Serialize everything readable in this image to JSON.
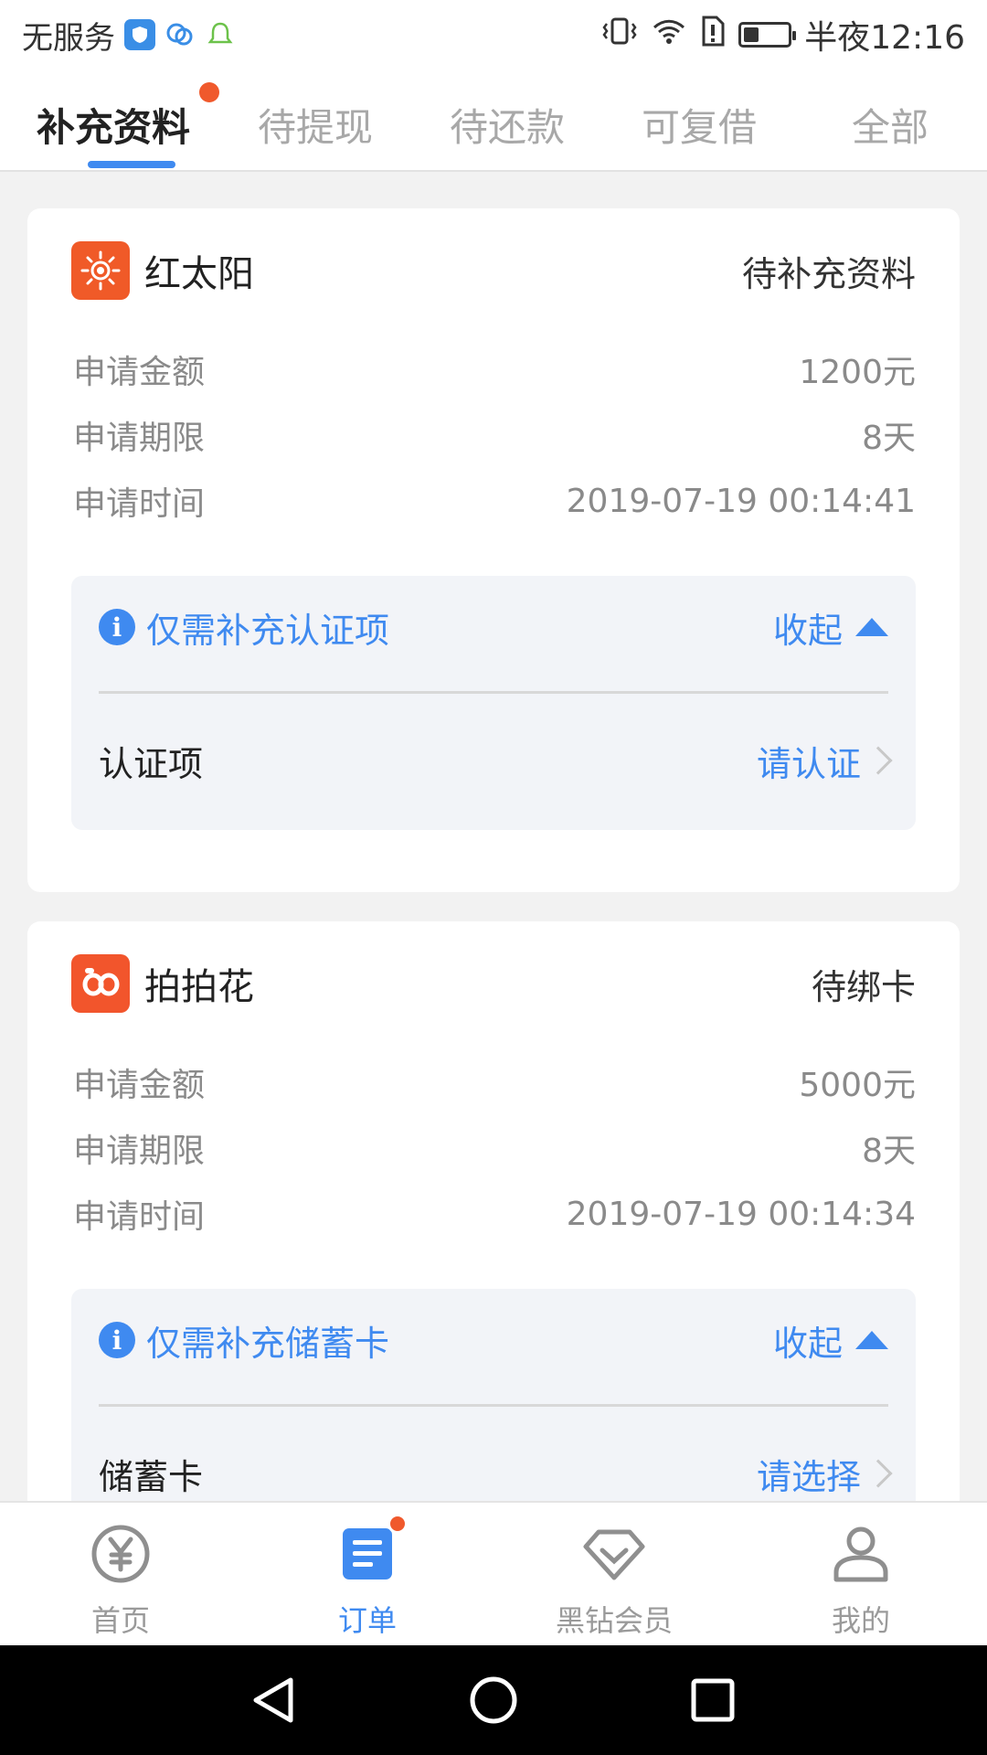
{
  "status_bar": {
    "carrier": "无服务",
    "time": "半夜12:16"
  },
  "tabs": [
    {
      "label": "补充资料",
      "active": true
    },
    {
      "label": "待提现"
    },
    {
      "label": "待还款"
    },
    {
      "label": "可复借"
    },
    {
      "label": "全部"
    }
  ],
  "cards": [
    {
      "brand": "红太阳",
      "status": "待补充资料",
      "rows": [
        {
          "label": "申请金额",
          "value": "1200元"
        },
        {
          "label": "申请期限",
          "value": "8天"
        },
        {
          "label": "申请时间",
          "value": "2019-07-19 00:14:41"
        }
      ],
      "panel": {
        "title": "仅需补充认证项",
        "collapse": "收起",
        "item_label": "认证项",
        "item_action": "请认证"
      }
    },
    {
      "brand": "拍拍花",
      "status": "待绑卡",
      "rows": [
        {
          "label": "申请金额",
          "value": "5000元"
        },
        {
          "label": "申请期限",
          "value": "8天"
        },
        {
          "label": "申请时间",
          "value": "2019-07-19 00:14:34"
        }
      ],
      "panel": {
        "title": "仅需补充储蓄卡",
        "collapse": "收起",
        "item_label": "储蓄卡",
        "item_action": "请选择"
      }
    }
  ],
  "bottom_nav": [
    {
      "label": "首页",
      "icon": "yen-coin-icon"
    },
    {
      "label": "订单",
      "icon": "order-list-icon",
      "active": true
    },
    {
      "label": "黑钻会员",
      "icon": "diamond-icon"
    },
    {
      "label": "我的",
      "icon": "user-icon"
    }
  ],
  "colors": {
    "accent": "#3f8af0",
    "badge": "#f0592c",
    "sun_logo": "#f05a28",
    "ppk_logo": "#f2552c"
  }
}
